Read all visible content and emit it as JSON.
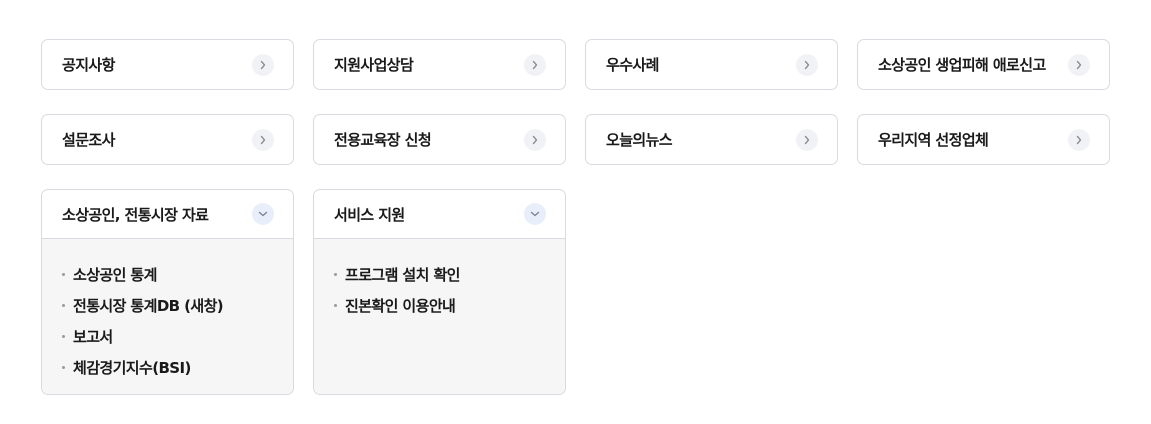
{
  "menu": {
    "cards": [
      {
        "title": "공지사항",
        "icon": "chevron-right-icon"
      },
      {
        "title": "지원사업상담",
        "icon": "chevron-right-icon"
      },
      {
        "title": "우수사례",
        "icon": "chevron-right-icon"
      },
      {
        "title": "소상공인 생업피해 애로신고",
        "icon": "chevron-right-icon"
      },
      {
        "title": "설문조사",
        "icon": "chevron-right-icon"
      },
      {
        "title": "전용교육장 신청",
        "icon": "chevron-right-icon"
      },
      {
        "title": "오늘의뉴스",
        "icon": "chevron-right-icon"
      },
      {
        "title": "우리지역 선정업체",
        "icon": "chevron-right-icon"
      },
      {
        "title": "소상공인, 전통시장 자료",
        "icon": "chevron-down-icon",
        "items": [
          "소상공인 통계",
          "전통시장 통계DB (새창)",
          "보고서",
          "체감경기지수(BSI)"
        ]
      },
      {
        "title": "서비스 지원",
        "icon": "chevron-down-icon",
        "items": [
          "프로그램 설치 확인",
          "진본확인 이용안내"
        ]
      }
    ]
  },
  "colors": {
    "border": "#d9dbe0",
    "expanded_bg": "#f6f6f7",
    "icon_bg": "#f1f2f5",
    "icon_bg_active": "#e9eefb",
    "text": "#1a1a1a"
  }
}
